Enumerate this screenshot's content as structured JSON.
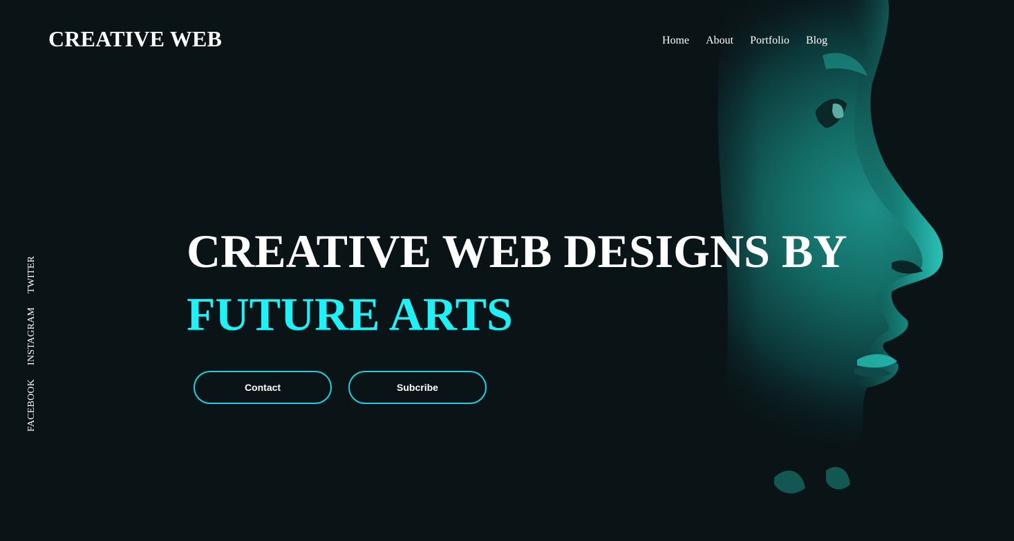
{
  "brand": {
    "logo_text": "CREATIVE WEB"
  },
  "nav": {
    "items": [
      {
        "label": "Home"
      },
      {
        "label": "About"
      },
      {
        "label": "Portfolio"
      },
      {
        "label": "Blog"
      }
    ]
  },
  "social": {
    "links": [
      {
        "label": "FACEBOOK"
      },
      {
        "label": "INSTAGRAM"
      },
      {
        "label": "TWITER"
      }
    ]
  },
  "hero": {
    "headline_line1": "CREATIVE WEB DESIGNS BY",
    "headline_line2": "FUTURE ARTS",
    "buttons": {
      "contact_label": "Contact",
      "subscribe_label": "Subcribe"
    },
    "image": {
      "subject": "face-profile-portrait"
    }
  },
  "colors": {
    "background": "#0a1417",
    "accent": "#1ef2f8",
    "button_border": "#1ad0e0",
    "text": "#ffffff",
    "portrait_tint": "#17a89c"
  }
}
